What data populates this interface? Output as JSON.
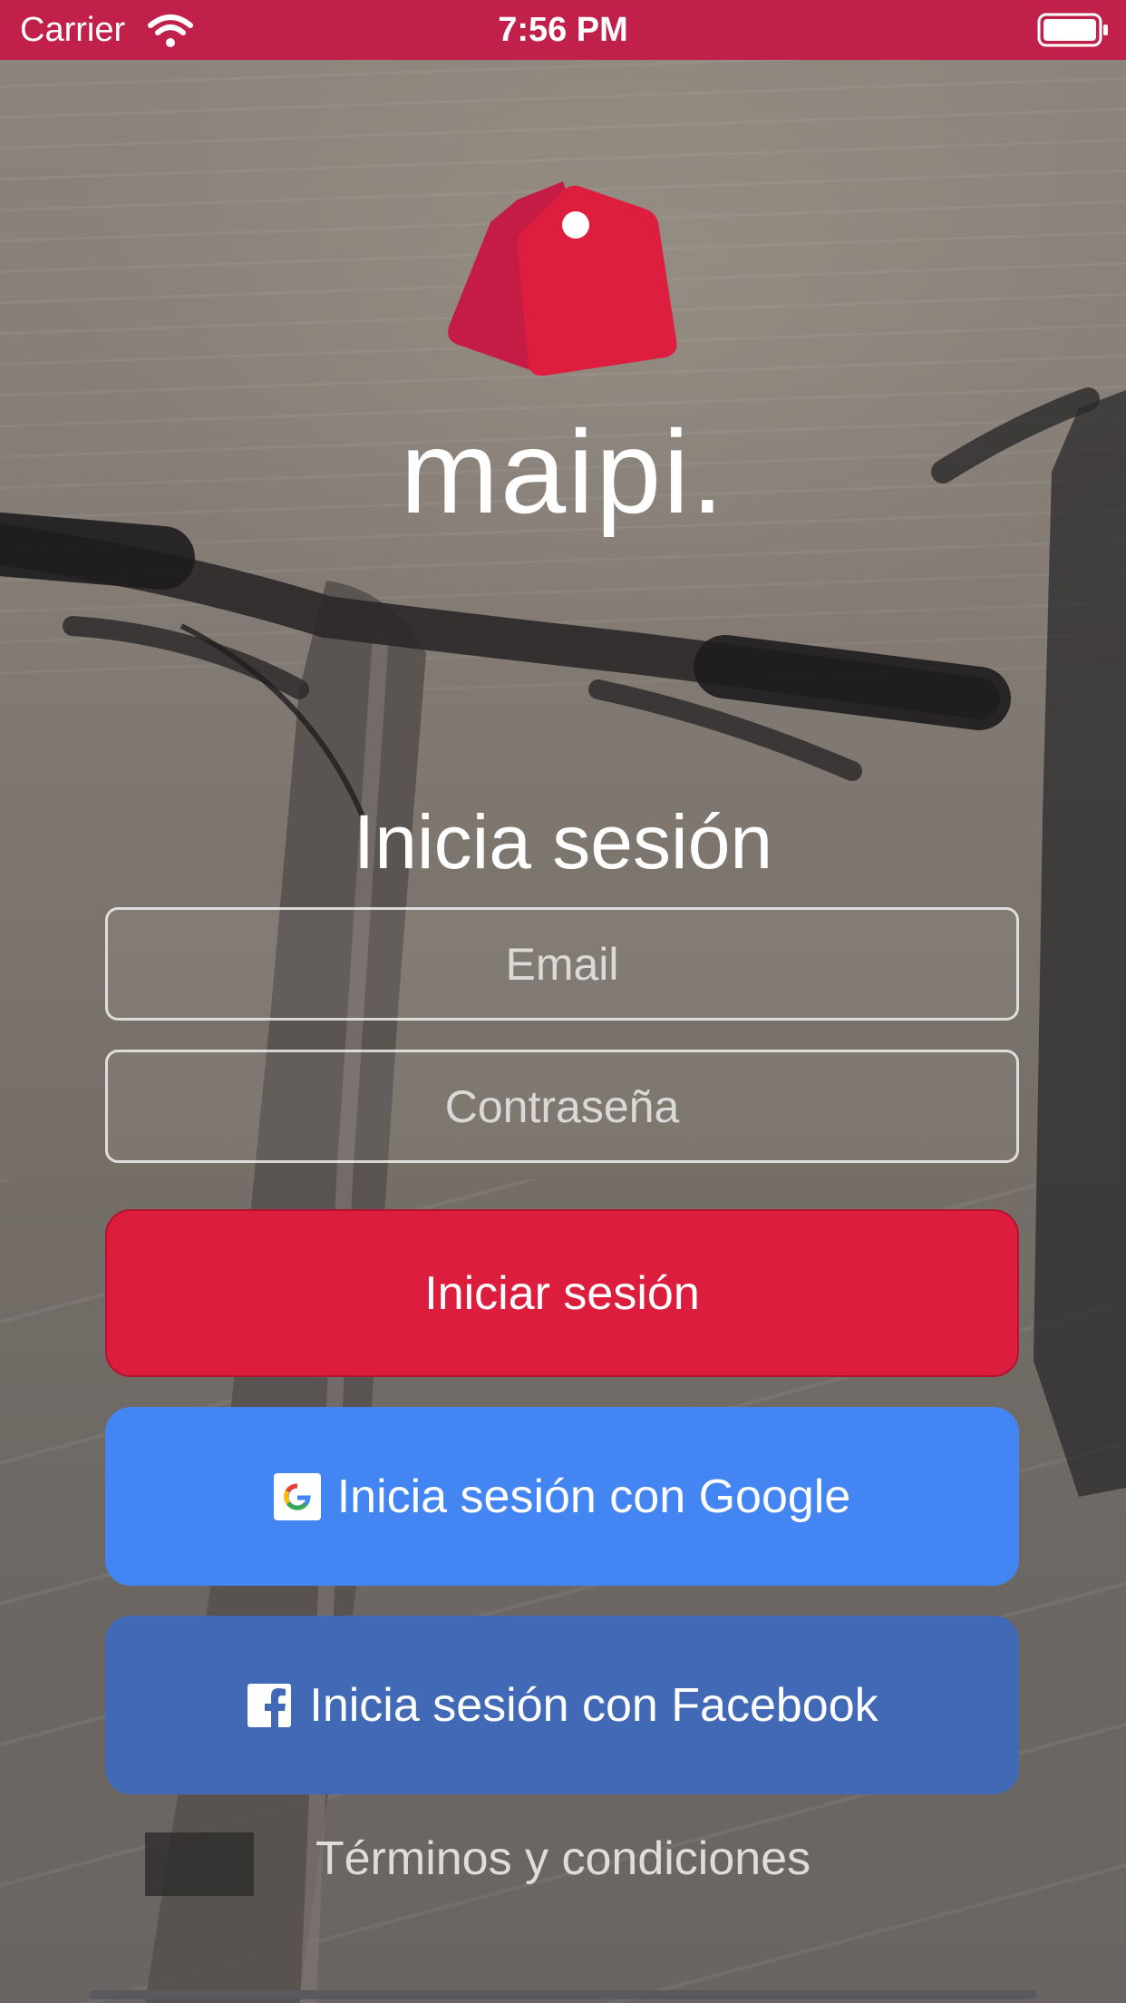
{
  "status_bar": {
    "carrier": "Carrier",
    "time": "7:56 PM",
    "background": "#c1204a"
  },
  "brand": {
    "name": "maipi.",
    "logo_icon": "price-tags-icon",
    "logo_colors": [
      "#c41c44",
      "#de1e3e"
    ]
  },
  "login": {
    "title": "Inicia sesión",
    "email_placeholder": "Email",
    "password_placeholder": "Contraseña",
    "submit_label": "Iniciar sesión",
    "submit_color": "#dc1d3d"
  },
  "social": {
    "google_label": "Inicia sesión con Google",
    "google_color": "#4385f2",
    "facebook_label": "Inicia sesión con Facebook",
    "facebook_color": "#4269b6"
  },
  "footer": {
    "terms_label": "Términos y condiciones"
  }
}
